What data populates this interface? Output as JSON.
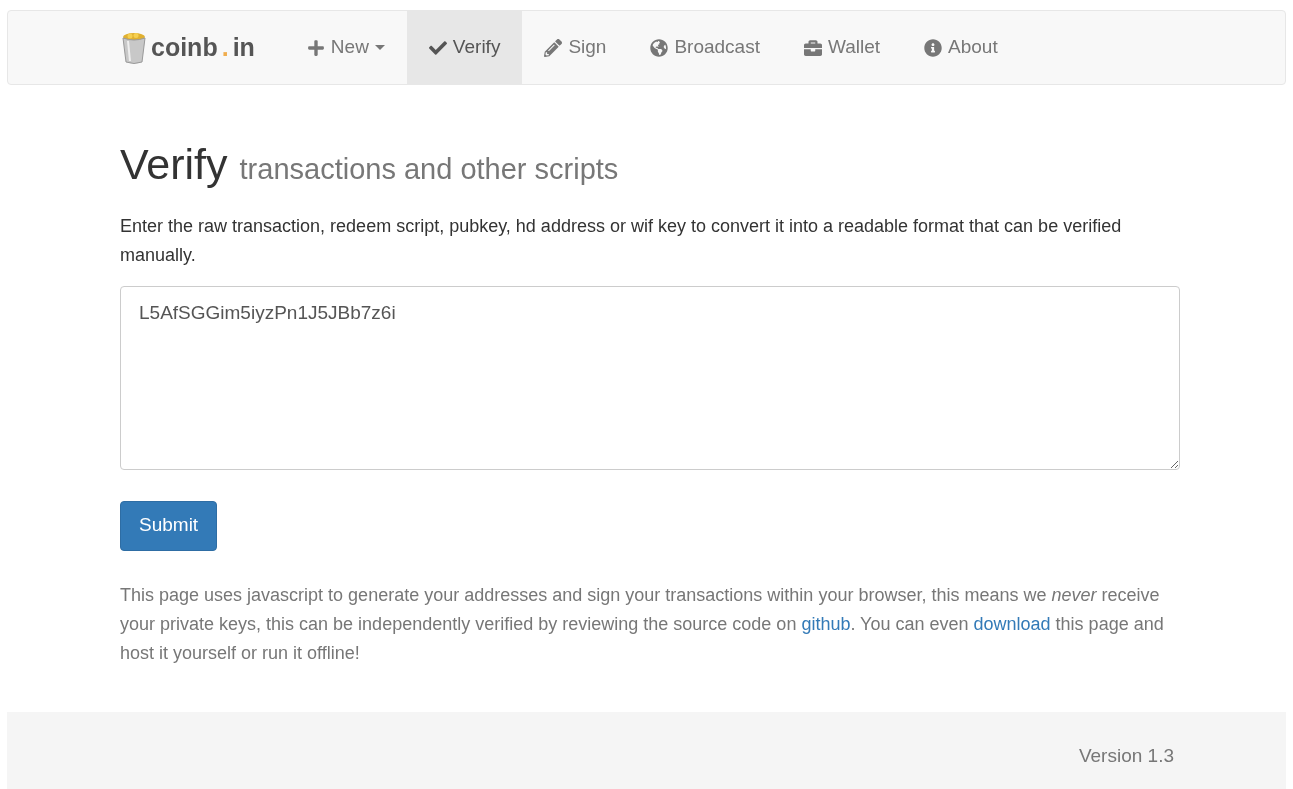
{
  "brand": {
    "parts": [
      {
        "text": "coinb",
        "color": "#555555"
      },
      {
        "text": ".",
        "color": "#f0ad4e"
      },
      {
        "text": "in",
        "color": "#555555"
      }
    ]
  },
  "nav": [
    {
      "label": "New",
      "dropdown": true,
      "selected": false
    },
    {
      "label": "Verify",
      "dropdown": false,
      "selected": true
    },
    {
      "label": "Sign",
      "dropdown": false,
      "selected": false
    },
    {
      "label": "Broadcast",
      "dropdown": false,
      "selected": false
    },
    {
      "label": "Wallet",
      "dropdown": false,
      "selected": false
    },
    {
      "label": "About",
      "dropdown": false,
      "selected": false
    }
  ],
  "heading": {
    "title": "Verify",
    "subtitle": "transactions and other scripts"
  },
  "intro": "Enter the raw transaction, redeem script, pubkey, hd address or wif key to convert it into a readable format that can be verified manually.",
  "input": {
    "value": "L5AfSGGim5iyzPn1J5JBb7z6i"
  },
  "submit": "Submit",
  "notice": [
    {
      "kind": "text",
      "text": "This page uses javascript to generate your addresses and sign your transactions within your browser, this means we *never* receive your private keys, this can be independently verified by reviewing the source code on "
    },
    {
      "kind": "link",
      "text": "github"
    },
    {
      "kind": "text",
      "text": ". You can even "
    },
    {
      "kind": "link",
      "text": "download"
    },
    {
      "kind": "text",
      "text": " this page and host it yourself or run it offline!"
    }
  ],
  "footer": {
    "version": "Version 1.3"
  }
}
